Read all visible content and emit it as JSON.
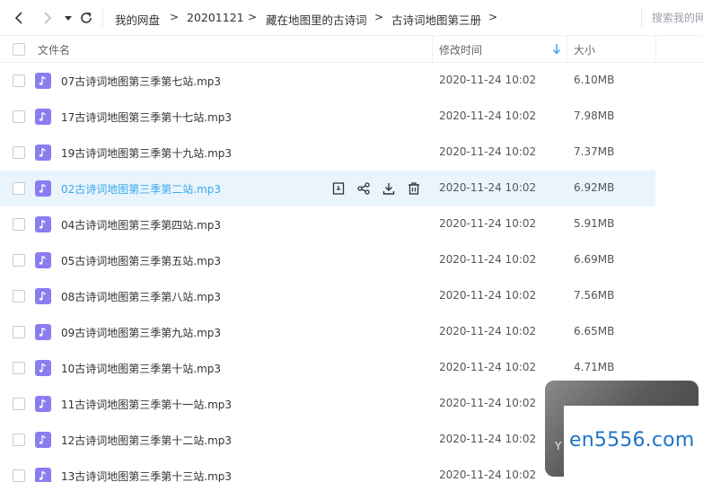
{
  "breadcrumb": [
    "我的网盘",
    "20201121",
    "藏在地图里的古诗词",
    "古诗词地图第三册"
  ],
  "search": {
    "placeholder": "搜索我的网"
  },
  "columns": {
    "name": "文件名",
    "modified": "修改时间",
    "size": "大小"
  },
  "accent_color": "#3aa8ec",
  "file_icon_color": "#8b7cf0",
  "hovered_row_index": 3,
  "files": [
    {
      "name": "07古诗词地图第三季第七站.mp3",
      "modified": "2020-11-24 10:02",
      "size": "6.10MB"
    },
    {
      "name": "17古诗词地图第三季第十七站.mp3",
      "modified": "2020-11-24 10:02",
      "size": "7.98MB"
    },
    {
      "name": "19古诗词地图第三季第十九站.mp3",
      "modified": "2020-11-24 10:02",
      "size": "7.37MB"
    },
    {
      "name": "02古诗词地图第三季第二站.mp3",
      "modified": "2020-11-24 10:02",
      "size": "6.92MB"
    },
    {
      "name": "04古诗词地图第三季第四站.mp3",
      "modified": "2020-11-24 10:02",
      "size": "5.91MB"
    },
    {
      "name": "05古诗词地图第三季第五站.mp3",
      "modified": "2020-11-24 10:02",
      "size": "6.69MB"
    },
    {
      "name": "08古诗词地图第三季第八站.mp3",
      "modified": "2020-11-24 10:02",
      "size": "7.56MB"
    },
    {
      "name": "09古诗词地图第三季第九站.mp3",
      "modified": "2020-11-24 10:02",
      "size": "6.65MB"
    },
    {
      "name": "10古诗词地图第三季第十站.mp3",
      "modified": "2020-11-24 10:02",
      "size": "4.71MB"
    },
    {
      "name": "11古诗词地图第三季第十一站.mp3",
      "modified": "2020-11-24 10:02",
      "size": ""
    },
    {
      "name": "12古诗词地图第三季第十二站.mp3",
      "modified": "2020-11-24 10:02",
      "size": ""
    },
    {
      "name": "13古诗词地图第三季第十三站.mp3",
      "modified": "2020-11-24 10:02",
      "size": ""
    }
  ],
  "watermark": {
    "text": "en5556.com",
    "letter": "Y"
  }
}
